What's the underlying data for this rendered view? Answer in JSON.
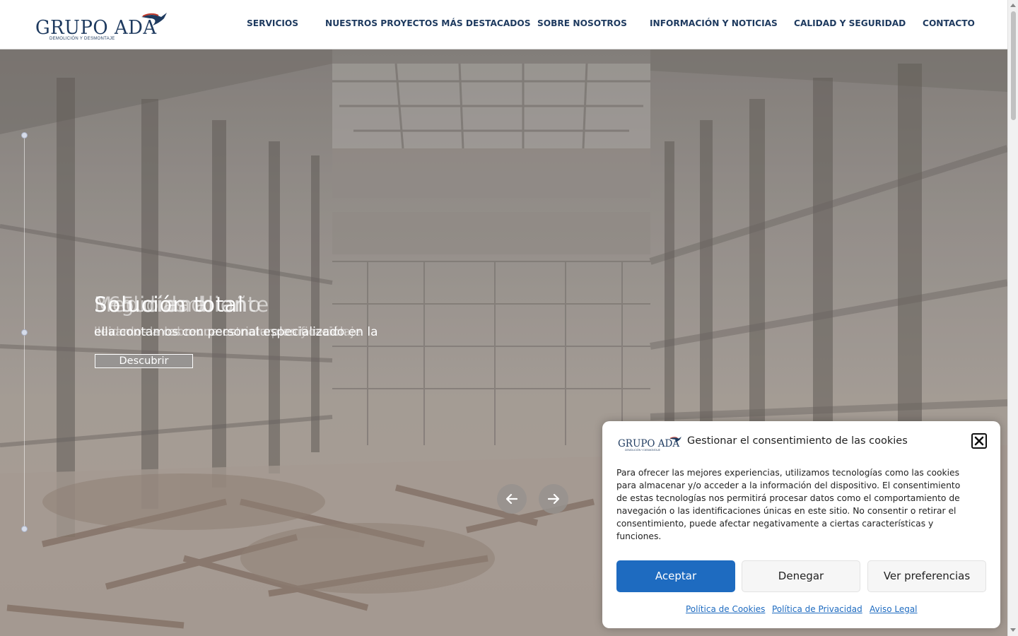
{
  "header": {
    "logo": {
      "name": "GRUPO ADA",
      "tagline": "DEMOLICIÓN Y DESMONTAJE"
    },
    "nav": [
      {
        "label": "SERVICIOS"
      },
      {
        "label": "NUESTROS PROYECTOS MÁS DESTACADOS"
      },
      {
        "label": "SOBRE NOSOTROS"
      },
      {
        "label": "INFORMACIÓN Y NOTICIAS"
      },
      {
        "label": "CALIDAD Y SEGURIDAD"
      },
      {
        "label": "CONTACTO"
      }
    ],
    "nav_color": "#1e3a5f"
  },
  "hero": {
    "title_layers": [
      "Seguridad",
      "365 días al año",
      "Medio ambiente",
      "Solución total"
    ],
    "subtitle_layers": [
      "ella contamos con personal especializado en la",
      "cuidado de los recursos naturales y reciclaje",
      "llevamos a cabo una estricta planificación"
    ],
    "button_label": "Descubrir",
    "slide_count": 3,
    "active_slide": 2
  },
  "cookie_dialog": {
    "logo_name": "GRUPO ADA",
    "logo_tagline": "DEMOLICIÓN Y DESMONTAJE",
    "title": "Gestionar el consentimiento de las cookies",
    "body": "Para ofrecer las mejores experiencias, utilizamos tecnologías como las cookies para almacenar y/o acceder a la información del dispositivo. El consentimiento de estas tecnologías nos permitirá procesar datos como el comportamiento de navegación o las identificaciones únicas en este sitio. No consentir o retirar el consentimiento, puede afectar negativamente a ciertas características y funciones.",
    "buttons": {
      "accept": "Aceptar",
      "deny": "Denegar",
      "preferences": "Ver preferencias"
    },
    "links": [
      "Política de Cookies",
      "Política de Privacidad",
      "Aviso Legal"
    ],
    "accent_color": "#1e6bc0"
  },
  "icons": {
    "prev": "arrow-left-icon",
    "next": "arrow-right-icon",
    "close": "close-icon"
  }
}
